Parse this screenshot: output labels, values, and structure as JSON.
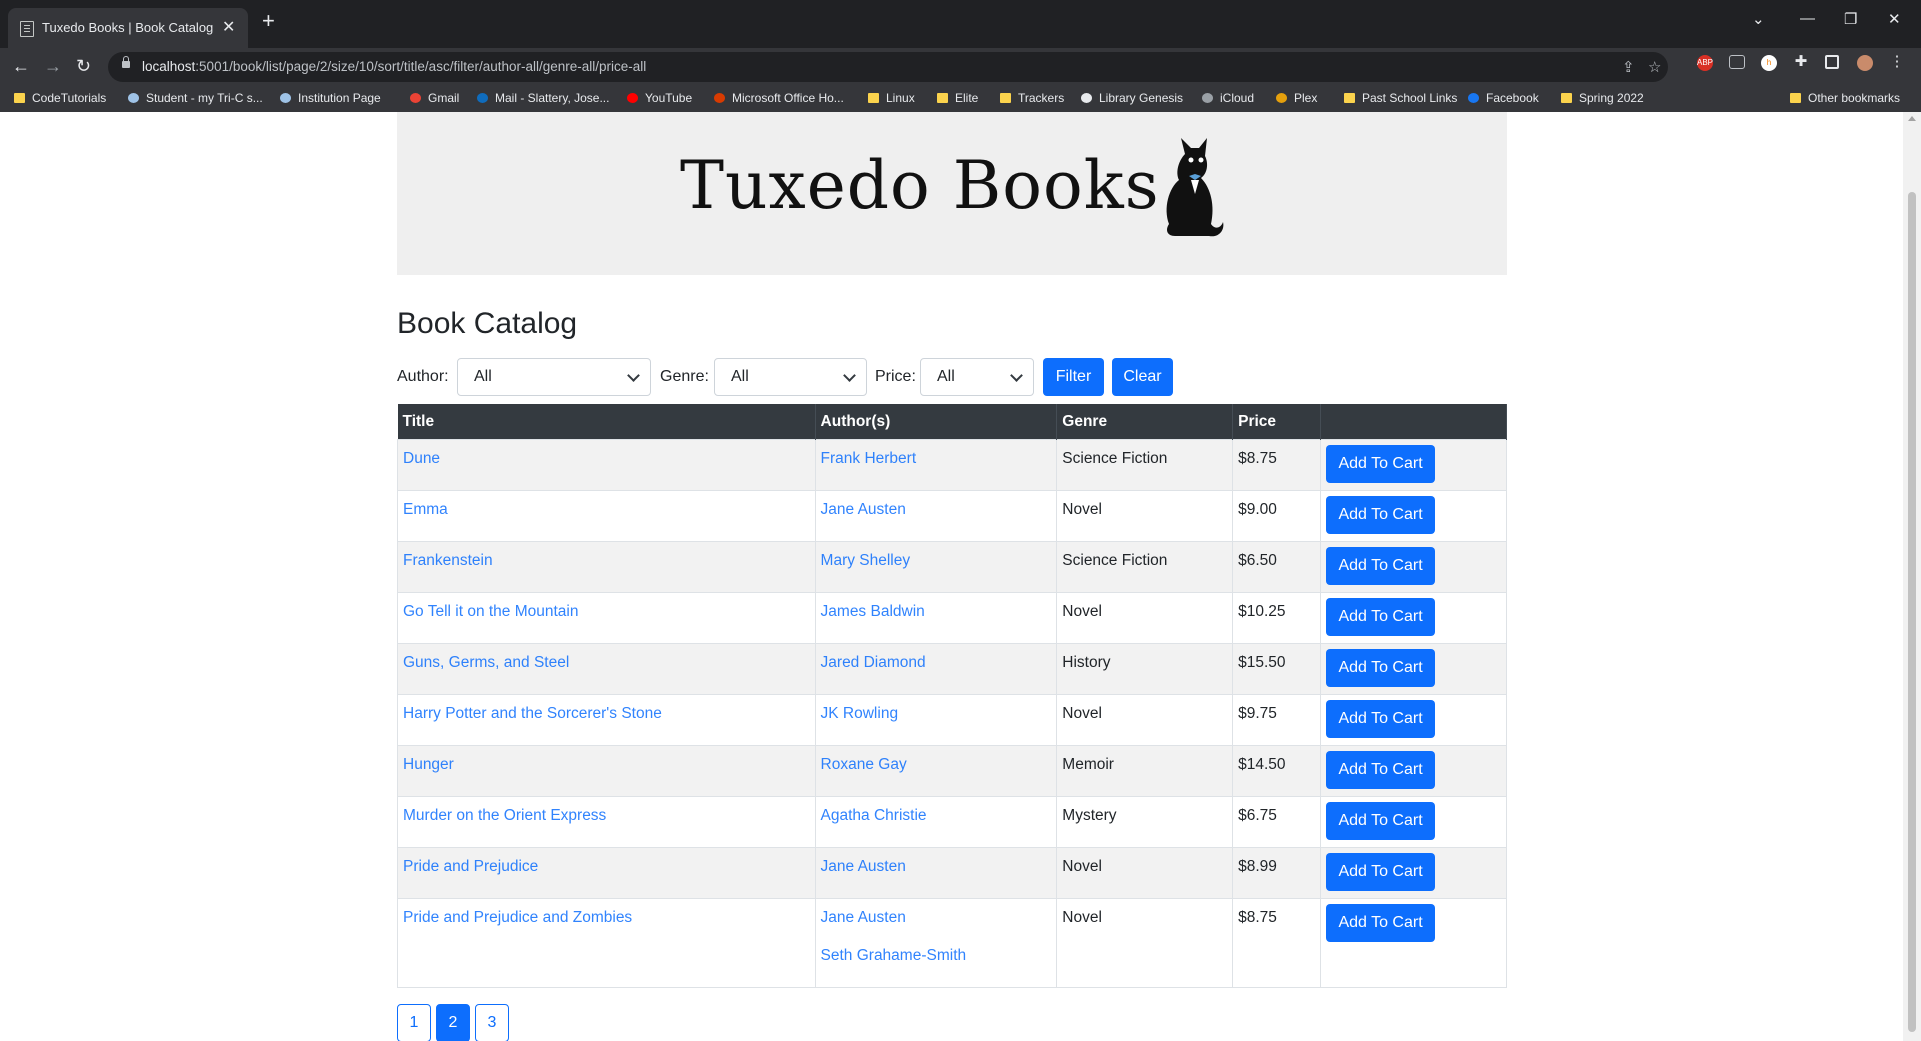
{
  "browser": {
    "tab_title": "Tuxedo Books | Book Catalog",
    "url_host": "localhost",
    "url_rest": ":5001/book/list/page/2/size/10/sort/title/asc/filter/author-all/genre-all/price-all",
    "bookmarks": [
      {
        "label": "CodeTutorials",
        "icon": "folder-icon"
      },
      {
        "label": "Student - my Tri-C s...",
        "icon": "snowflake-icon"
      },
      {
        "label": "Institution Page",
        "icon": "snowflake-icon"
      },
      {
        "label": "Gmail",
        "icon": "gmail-icon"
      },
      {
        "label": "Mail - Slattery, Jose...",
        "icon": "outlook-icon"
      },
      {
        "label": "YouTube",
        "icon": "youtube-icon"
      },
      {
        "label": "Microsoft Office Ho...",
        "icon": "office-icon"
      },
      {
        "label": "Linux",
        "icon": "folder-icon"
      },
      {
        "label": "Elite",
        "icon": "folder-icon"
      },
      {
        "label": "Trackers",
        "icon": "folder-icon"
      },
      {
        "label": "Library Genesis",
        "icon": "book-icon"
      },
      {
        "label": "iCloud",
        "icon": "apple-icon"
      },
      {
        "label": "Plex",
        "icon": "plex-icon"
      },
      {
        "label": "Past School Links",
        "icon": "folder-icon"
      },
      {
        "label": "Facebook",
        "icon": "facebook-icon"
      },
      {
        "label": "Spring 2022",
        "icon": "folder-icon"
      }
    ],
    "other_bookmarks": "Other bookmarks"
  },
  "site": {
    "logo_text": "Tuxedo Books"
  },
  "catalog": {
    "heading": "Book Catalog",
    "filters": {
      "author_label": "Author:",
      "author_value": "All",
      "genre_label": "Genre:",
      "genre_value": "All",
      "price_label": "Price:",
      "price_value": "All",
      "filter_button": "Filter",
      "clear_button": "Clear"
    },
    "columns": [
      "Title",
      "Author(s)",
      "Genre",
      "Price",
      ""
    ],
    "cart_button": "Add To Cart",
    "rows": [
      {
        "title": "Dune",
        "authors": [
          "Frank Herbert"
        ],
        "genre": "Science Fiction",
        "price": "$8.75"
      },
      {
        "title": "Emma",
        "authors": [
          "Jane Austen"
        ],
        "genre": "Novel",
        "price": "$9.00"
      },
      {
        "title": "Frankenstein",
        "authors": [
          "Mary Shelley"
        ],
        "genre": "Science Fiction",
        "price": "$6.50"
      },
      {
        "title": "Go Tell it on the Mountain",
        "authors": [
          "James Baldwin"
        ],
        "genre": "Novel",
        "price": "$10.25"
      },
      {
        "title": "Guns, Germs, and Steel",
        "authors": [
          "Jared Diamond"
        ],
        "genre": "History",
        "price": "$15.50"
      },
      {
        "title": "Harry Potter and the Sorcerer's Stone",
        "authors": [
          "JK Rowling"
        ],
        "genre": "Novel",
        "price": "$9.75"
      },
      {
        "title": "Hunger",
        "authors": [
          "Roxane Gay"
        ],
        "genre": "Memoir",
        "price": "$14.50"
      },
      {
        "title": "Murder on the Orient Express",
        "authors": [
          "Agatha Christie"
        ],
        "genre": "Mystery",
        "price": "$6.75"
      },
      {
        "title": "Pride and Prejudice",
        "authors": [
          "Jane Austen"
        ],
        "genre": "Novel",
        "price": "$8.99"
      },
      {
        "title": "Pride and Prejudice and Zombies",
        "authors": [
          "Jane Austen",
          "Seth Grahame-Smith"
        ],
        "genre": "Novel",
        "price": "$8.75"
      }
    ],
    "pages": [
      {
        "label": "1",
        "active": false
      },
      {
        "label": "2",
        "active": true
      },
      {
        "label": "3",
        "active": false
      }
    ]
  },
  "colors": {
    "primary": "#0d6efd",
    "table_header": "#343a40",
    "banner_bg": "#efefef"
  }
}
